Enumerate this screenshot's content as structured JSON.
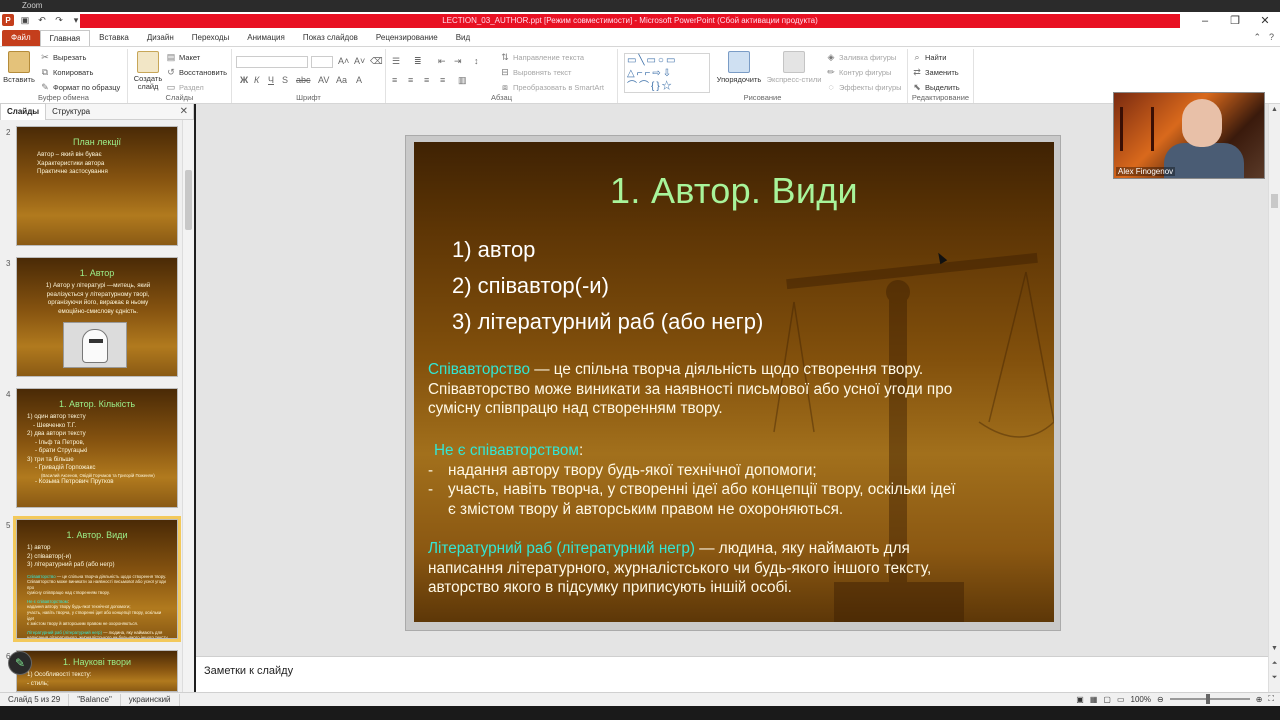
{
  "window": {
    "top_label": "Zoom",
    "title": "LECTION_03_AUTHOR.ppt [Режим совместимости] - Microsoft PowerPoint (Сбой активации продукта)"
  },
  "tabs": [
    {
      "label": "Файл"
    },
    {
      "label": "Главная"
    },
    {
      "label": "Вставка"
    },
    {
      "label": "Дизайн"
    },
    {
      "label": "Переходы"
    },
    {
      "label": "Анимация"
    },
    {
      "label": "Показ слайдов"
    },
    {
      "label": "Рецензирование"
    },
    {
      "label": "Вид"
    }
  ],
  "ribbon": {
    "clipboard": {
      "label": "Буфер обмена",
      "paste": "Вставить",
      "cut": "Вырезать",
      "copy": "Копировать",
      "format": "Формат по образцу"
    },
    "slides": {
      "label": "Слайды",
      "new_slide": "Создать слайд",
      "layout": "Макет",
      "reset": "Восстановить",
      "section": "Раздел"
    },
    "font": {
      "label": "Шрифт"
    },
    "paragraph": {
      "label": "Абзац",
      "text_dir": "Направление текста",
      "align_text": "Выровнять текст",
      "smartart": "Преобразовать в SmartArt"
    },
    "drawing": {
      "label": "Рисование",
      "arrange": "Упорядочить",
      "quick_styles": "Экспресс-стили",
      "fill": "Заливка фигуры",
      "outline": "Контур фигуры",
      "effects": "Эффекты фигуры"
    },
    "editing": {
      "label": "Редактирование",
      "find": "Найти",
      "replace": "Заменить",
      "select": "Выделить"
    }
  },
  "left_pane": {
    "tabs": [
      "Слайды",
      "Структура"
    ],
    "thumbs": [
      {
        "num": "2",
        "title": "План лекції",
        "lines": [
          "Автор – який він буває",
          "Характеристики автора",
          "Практичне застосування"
        ]
      },
      {
        "num": "3",
        "title": "1. Автор",
        "lines": [
          "1) Автор у літературі —митець, який",
          "реалізується у літературному творі,",
          "організуючи його, виражає в ньому",
          "емоційно-смислову єдність."
        ]
      },
      {
        "num": "4",
        "title": "1. Автор. Кількість",
        "lines": [
          "1) один автор тексту",
          "- Шевченко Т.Г.",
          "2) два автори тексту",
          "- Ільф та Петров,",
          "- брати Стругацькі",
          "3) три та більше",
          "- Гривадій Горпожакс",
          "(Василий Аксенов, Овідій Горчаков та Григорій Поженян)",
          "- Козьма Петрович Прутков"
        ]
      },
      {
        "num": "5",
        "title": "1. Автор. Види",
        "lines": [
          "1) автор",
          "2) співавтор(-и)",
          "3) літературний раб (або негр)"
        ]
      },
      {
        "num": "6",
        "title": "1. Наукові твори",
        "lines": [
          "1) Особливості тексту:",
          "- стиль;"
        ]
      }
    ]
  },
  "slide": {
    "title": "1. Автор. Види",
    "list": [
      "1) автор",
      "2) співавтор(-и)",
      "3) літературний раб (або негр)"
    ],
    "p1_term": "Співавторство",
    "p1_rest": " — це спільна творча діяльність щодо створення твору.",
    "p1_line2": "Співавторство може виникати за наявності письмової або усної угоди про",
    "p1_line3": "сумісну співпрацю над створенням твору.",
    "p2_term": "Не є співавторством",
    "p2_colon": ":",
    "bullets": [
      {
        "dash": "-",
        "text": "надання автору твору будь-якої технічної допомоги;"
      },
      {
        "dash": "-",
        "text": "участь, навіть творча, у створенні ідеї або концепції твору, оскільки ідеї"
      },
      {
        "dash": "",
        "text": "є змістом твору й авторським правом не охороняються."
      }
    ],
    "p3_term": "Літературний раб (літературний негр)",
    "p3_rest": " — людина, яку наймають для",
    "p3_line2": "написання літературного, журналістського чи будь-якого іншого тексту,",
    "p3_line3": "авторство якого в підсумку приписують іншій особі."
  },
  "notes_placeholder": "Заметки к слайду",
  "status": {
    "slide_counter": "Слайд 5 из 29",
    "theme": "\"Balance\"",
    "language": "украинский",
    "zoom": "100%"
  },
  "video": {
    "name": "Alex Finogenov"
  },
  "colors": {
    "file_tab": "#c43e1c",
    "title_bar_error": "#e81123",
    "slide_title": "#a8f49a",
    "slide_term": "#33e6d4"
  }
}
